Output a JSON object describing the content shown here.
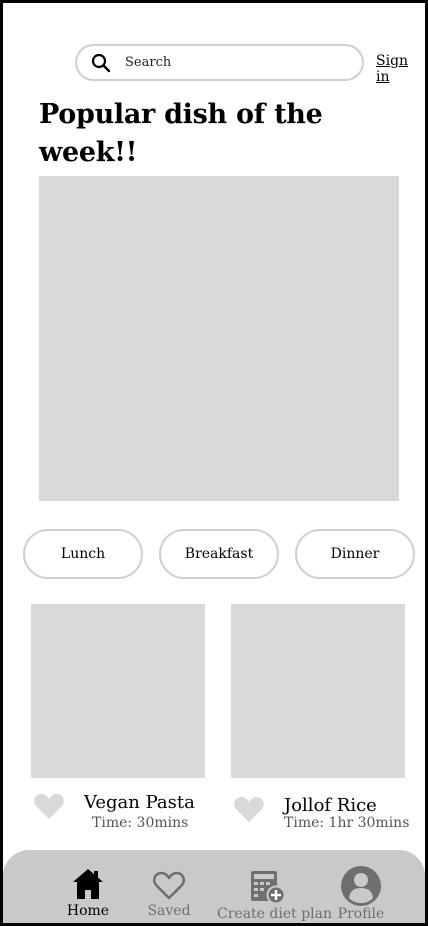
{
  "header": {
    "search_label": "Search",
    "signin_label": "Sign in"
  },
  "feature": {
    "title": "Popular dish of the week!!"
  },
  "meal_filters": [
    "Lunch",
    "Breakfast",
    "Dinner"
  ],
  "dishes": [
    {
      "name": "Vegan Pasta",
      "time": "Time: 30mins"
    },
    {
      "name": "Jollof Rice",
      "time": "Time: 1hr 30mins"
    }
  ],
  "nav": [
    {
      "label": "Home",
      "icon": "home-icon",
      "active": true
    },
    {
      "label": "Saved",
      "icon": "heart-icon",
      "active": false
    },
    {
      "label": "Create diet plan",
      "icon": "calculator-add-icon",
      "active": false
    },
    {
      "label": "Profile",
      "icon": "profile-icon",
      "active": false
    }
  ],
  "colors": {
    "placeholder": "#d9d9d9",
    "navbar": "#c9c9c9",
    "border": "#cfcfcf",
    "inactive": "#6f6f6f"
  }
}
